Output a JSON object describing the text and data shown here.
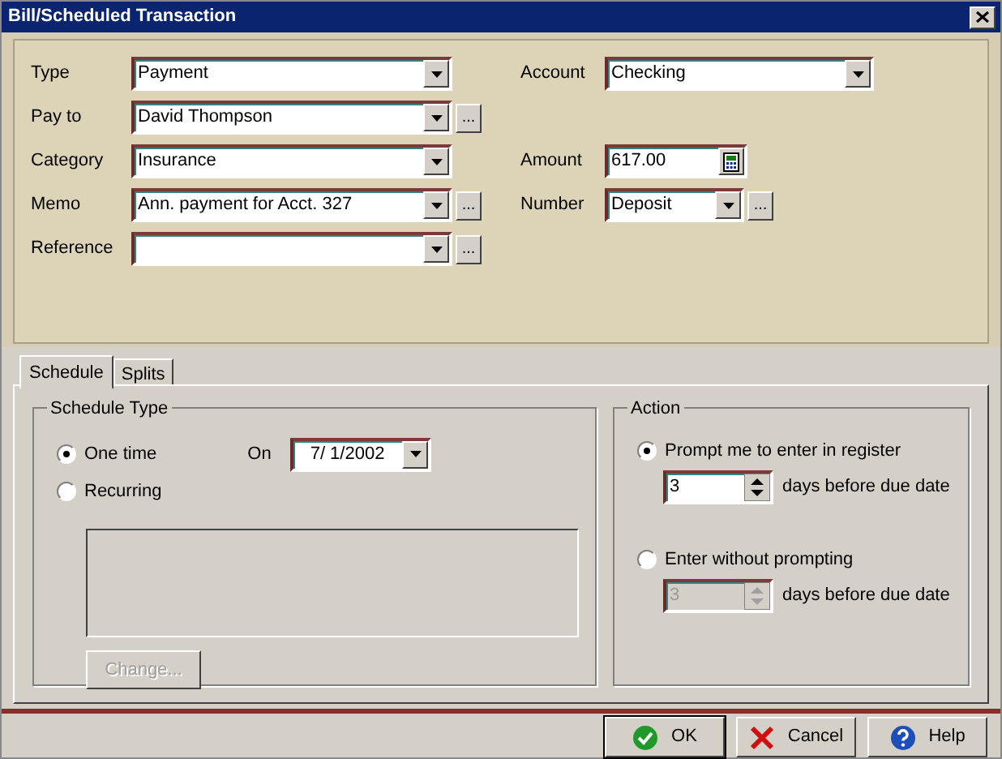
{
  "window": {
    "title": "Bill/Scheduled Transaction"
  },
  "left_fields": [
    {
      "label": "Type",
      "value": "Payment",
      "kind": "combo"
    },
    {
      "label": "Pay to",
      "value": "David Thompson",
      "kind": "combo",
      "more": "..."
    },
    {
      "label": "Category",
      "value": "Insurance",
      "kind": "combo"
    },
    {
      "label": "Memo",
      "value": "Ann. payment for Acct. 327",
      "kind": "combo",
      "more": "..."
    },
    {
      "label": "Reference",
      "kind": "combo",
      "more": "..."
    }
  ],
  "right_fields": [
    {
      "label": "Account",
      "value": "Checking",
      "kind": "combo"
    },
    {
      "label": "Amount",
      "value": "617.00",
      "kind": "calc"
    },
    {
      "label": "Number",
      "value": "Deposit",
      "kind": "combo",
      "more": "..."
    }
  ],
  "tabs": [
    {
      "label": "Schedule",
      "selected": true
    },
    {
      "label": "Splits",
      "selected": false
    }
  ],
  "schedule_type": {
    "title": "Schedule Type",
    "options": [
      {
        "label": "One time",
        "selected": true
      },
      {
        "label": "Recurring",
        "selected": false
      }
    ],
    "on_label": "On",
    "date": "7/ 1/2002",
    "change_button": {
      "label": "Change...",
      "disabled": true
    }
  },
  "action": {
    "title": "Action",
    "options": [
      {
        "label": "Prompt me to enter in register",
        "selected": true,
        "days": "3",
        "days_label": "days before due date",
        "disabled": false
      },
      {
        "label": "Enter without prompting",
        "selected": false,
        "days": "3",
        "days_label": "days before due date",
        "disabled": true
      }
    ]
  },
  "buttons": [
    {
      "label": "OK",
      "kind": "ok"
    },
    {
      "label": "Cancel",
      "kind": "cancel"
    },
    {
      "label": "Help",
      "kind": "help"
    }
  ]
}
